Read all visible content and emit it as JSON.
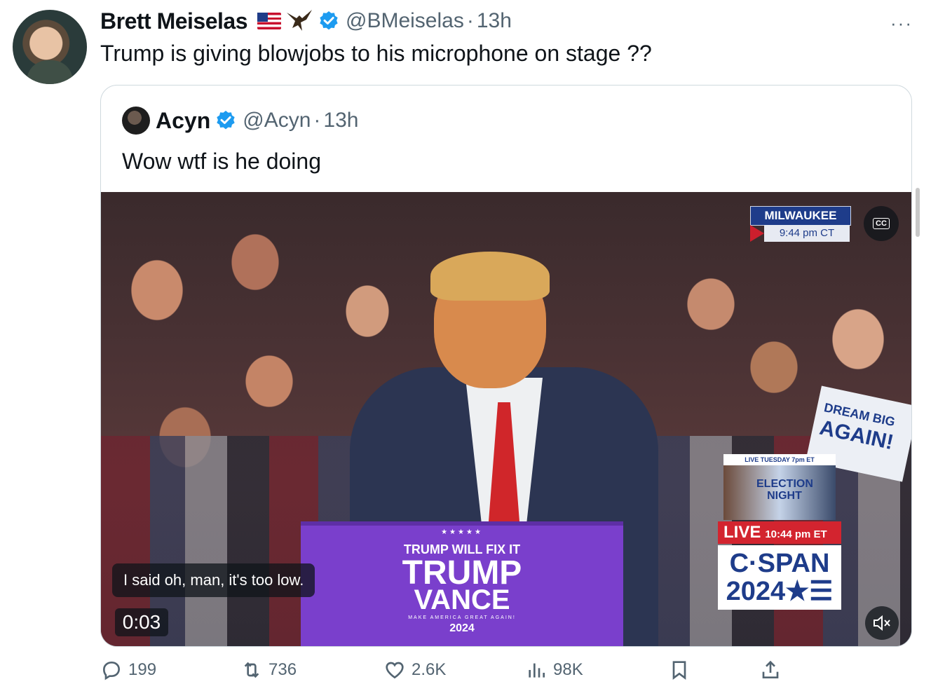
{
  "tweet": {
    "author_name": "Brett Meiselas",
    "handle": "@BMeiselas",
    "separator": "·",
    "time": "13h",
    "text": "Trump is giving blowjobs to his microphone on stage ??",
    "more_label": "···"
  },
  "quoted_tweet": {
    "author_name": "Acyn",
    "handle": "@Acyn",
    "separator": "·",
    "time": "13h",
    "text": "Wow wtf is he doing"
  },
  "video": {
    "caption": "I said oh, man, it's too low.",
    "timestamp": "0:03",
    "cc_label": "CC",
    "location_badge": {
      "city": "MILWAUKEE",
      "local_time": "9:44 pm CT"
    },
    "podium": {
      "stars": "★★★★★",
      "line1": "TRUMP WILL FIX IT",
      "line2": "TRUMP",
      "line3": "VANCE",
      "line4": "MAKE AMERICA GREAT AGAIN!",
      "line5": "2024"
    },
    "cspan_bug": {
      "promo": "LIVE TUESDAY 7pm ET",
      "promo_title_1": "ELECTION",
      "promo_title_2": "NIGHT",
      "live_label": "LIVE",
      "live_time": "10:44 pm ET",
      "brand_1": "C·SPAN",
      "brand_2": "2024★☰"
    },
    "sign": {
      "line1": "DREAM BIG",
      "line2": "AGAIN!"
    }
  },
  "actions": {
    "replies": "199",
    "reposts": "736",
    "likes": "2.6K",
    "views": "98K"
  },
  "colors": {
    "text_primary": "#0f1419",
    "text_secondary": "#536471",
    "verified_blue": "#1d9bf0",
    "border": "#cfd9de"
  },
  "icons": [
    "reply-icon",
    "repost-icon",
    "like-icon",
    "views-icon",
    "bookmark-icon",
    "share-icon",
    "verified-badge-icon",
    "flag-us-icon",
    "eagle-icon",
    "cc-icon",
    "mute-icon"
  ]
}
